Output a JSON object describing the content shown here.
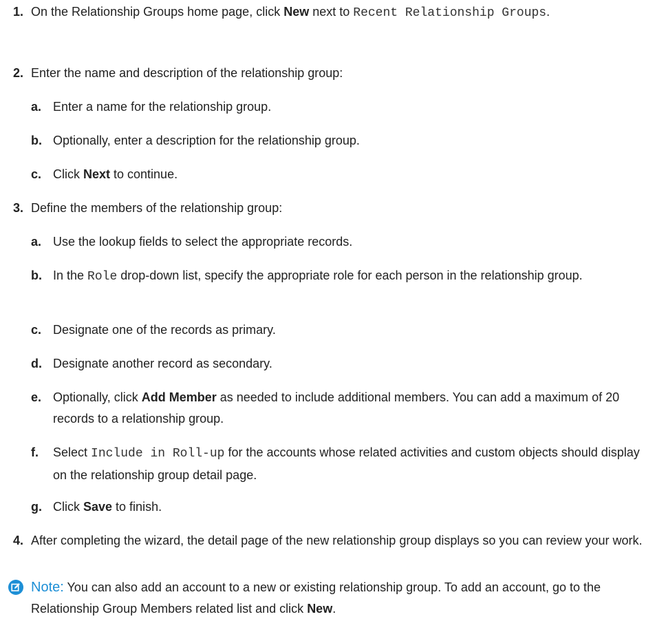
{
  "steps": [
    {
      "num": "1.",
      "t1": "On the Relationship Groups home page, click ",
      "b1": "New",
      "t2": " next to ",
      "m1": "Recent Relationship Groups",
      "t3": "."
    },
    {
      "num": "2.",
      "text": "Enter the name and description of the relationship group:",
      "subs": [
        {
          "num": "a.",
          "text": "Enter a name for the relationship group."
        },
        {
          "num": "b.",
          "text": "Optionally, enter a description for the relationship group."
        },
        {
          "num": "c.",
          "t1": "Click ",
          "b1": "Next",
          "t2": " to continue."
        }
      ]
    },
    {
      "num": "3.",
      "text": "Define the members of the relationship group:",
      "subs": [
        {
          "num": "a.",
          "text": "Use the lookup fields to select the appropriate records."
        },
        {
          "num": "b.",
          "t1": "In the ",
          "m1": "Role",
          "t2": " drop-down list, specify the appropriate role for each person in the relationship group."
        },
        {
          "num": "c.",
          "text": "Designate one of the records as primary."
        },
        {
          "num": "d.",
          "text": "Designate another record as secondary."
        },
        {
          "num": "e.",
          "t1": "Optionally, click ",
          "b1": "Add Member",
          "t2": " as needed to include additional members. You can add a maximum of 20 records to a relationship group."
        },
        {
          "num": "f.",
          "t1": "Select ",
          "m1": "Include in Roll-up",
          "t2": " for the accounts whose related activities and custom objects should display on the relationship group detail page."
        },
        {
          "num": "g.",
          "t1": "Click ",
          "b1": "Save",
          "t2": " to finish."
        }
      ]
    },
    {
      "num": "4.",
      "text": "After completing the wizard, the detail page of the new relationship group displays so you can review your work."
    }
  ],
  "note": {
    "label": "Note:",
    "t1": " You can also add an account to a new or existing relationship group. To add an account, go to the Relationship Group Members related list and click ",
    "b1": "New",
    "t2": "."
  },
  "colors": {
    "text": "#222222",
    "note_accent": "#1d8fd6"
  },
  "icons": {
    "note": "note-edit-icon"
  }
}
